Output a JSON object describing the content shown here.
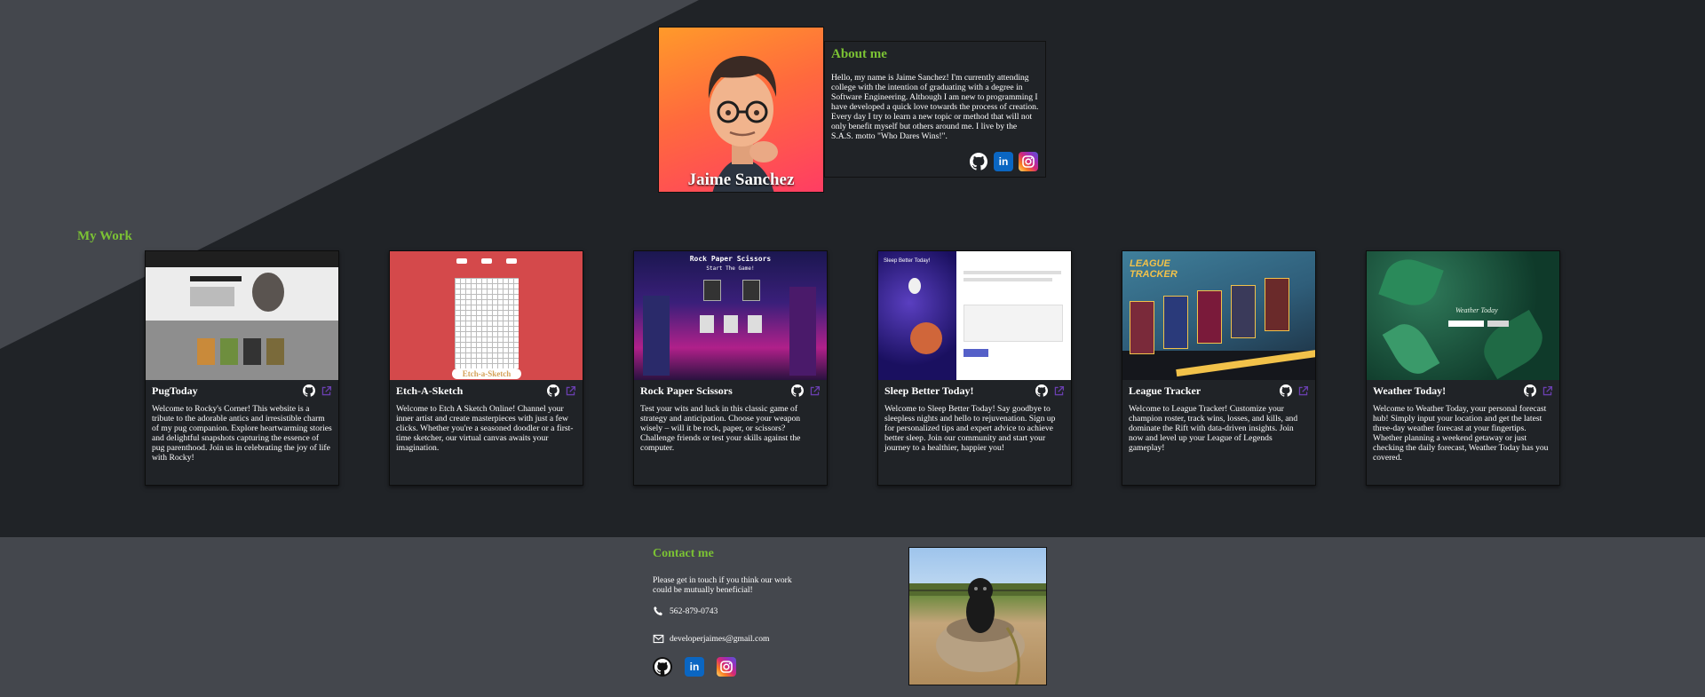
{
  "profile": {
    "name": "Jaime Sanchez"
  },
  "about": {
    "title": "About me",
    "text": "Hello, my name is Jaime Sanchez! I'm currently attending college with the intention of graduating with a degree in Software Engineering. Although I am new to programming I have developed a quick love towards the process of creation. Every day I try to learn a new topic or method that will not only benefit myself but others around me. I live by the S.A.S. motto \"Who Dares Wins!\".",
    "socials": [
      {
        "icon": "github-icon"
      },
      {
        "icon": "linkedin-icon",
        "label": "in"
      },
      {
        "icon": "instagram-icon"
      }
    ]
  },
  "work": {
    "title": "My Work",
    "projects": [
      {
        "title": "PugToday",
        "description": "Welcome to Rocky's Corner! This website is a tribute to the adorable antics and irresistible charm of my pug companion. Explore heartwarming stories and delightful snapshots capturing the essence of pug parenthood. Join us in celebrating the joy of life with Rocky!"
      },
      {
        "title": "Etch-A-Sketch",
        "description": "Welcome to Etch A Sketch Online! Channel your inner artist and create masterpieces with just a few clicks. Whether you're a seasoned doodler or a first-time sketcher, our virtual canvas awaits your imagination.",
        "thumb_label": "Etch-a-Sketch"
      },
      {
        "title": "Rock Paper Scissors",
        "description": "Test your wits and luck in this classic game of strategy and anticipation. Choose your weapon wisely – will it be rock, paper, or scissors? Challenge friends or test your skills against the computer.",
        "thumb_label": "Rock Paper Scissors",
        "thumb_sub": "Start The Game!"
      },
      {
        "title": "Sleep Better Today!",
        "description": "Welcome to Sleep Better Today! Say goodbye to sleepless nights and hello to rejuvenation. Sign up for personalized tips and expert advice to achieve better sleep. Join our community and start your journey to a healthier, happier you!",
        "thumb_label": "Sleep Better Today!"
      },
      {
        "title": "League Tracker",
        "description": "Welcome to League Tracker! Customize your champion roster, track wins, losses, and kills, and dominate the Rift with data-driven insights. Join now and level up your League of Legends gameplay!",
        "thumb_label": "LEAGUE TRACKER"
      },
      {
        "title": "Weather Today!",
        "description": "Welcome to Weather Today, your personal forecast hub! Simply input your location and get the latest three-day weather forecast at your fingertips. Whether planning a weekend getaway or just checking the daily forecast, Weather Today has you covered.",
        "thumb_label": "Weather Today"
      }
    ]
  },
  "contact": {
    "title": "Contact me",
    "text": "Please get in touch if you think our work could be mutually beneficial!",
    "phone": "562-879-0743",
    "email": "developerjaimes@gmail.com"
  },
  "colors": {
    "accent": "#7bc234",
    "background": "#202327",
    "panel": "#44474d"
  }
}
